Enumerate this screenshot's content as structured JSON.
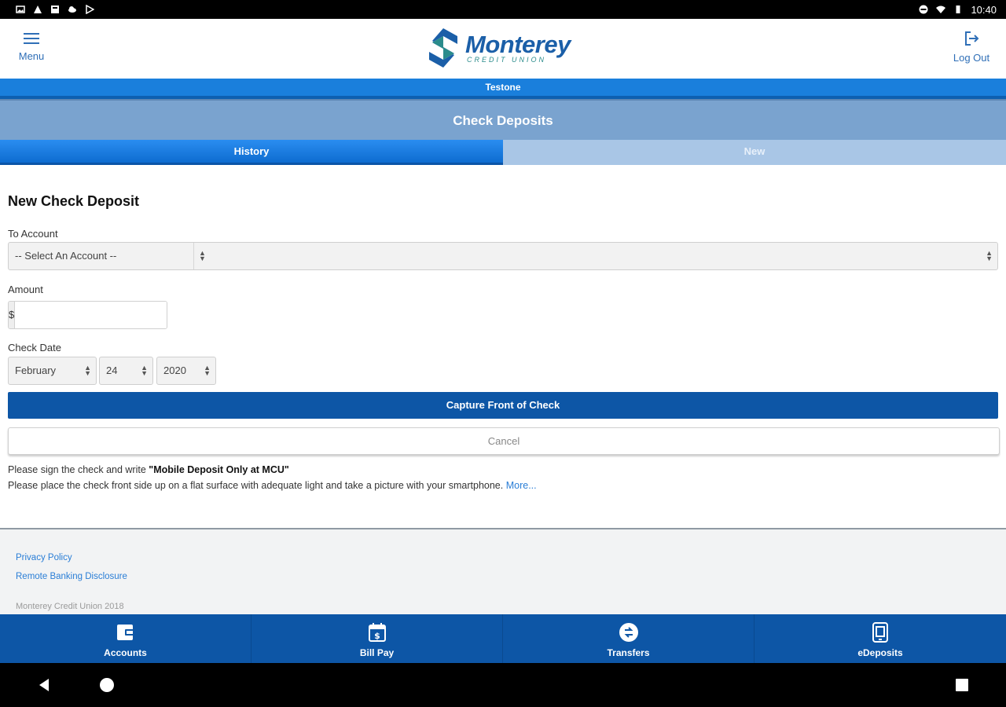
{
  "status_bar": {
    "time": "10:40"
  },
  "header": {
    "menu_label": "Menu",
    "logout_label": "Log Out",
    "logo_title": "Monterey",
    "logo_subtitle": "CREDIT UNION"
  },
  "user_bar": {
    "name": "Testone"
  },
  "page_title": "Check Deposits",
  "tabs": [
    {
      "label": "History",
      "active": true
    },
    {
      "label": "New",
      "active": false
    }
  ],
  "form": {
    "title": "New Check Deposit",
    "account_label": "To Account",
    "account_value": "-- Select An Account --",
    "amount_label": "Amount",
    "currency_symbol": "$",
    "amount_value": "",
    "date_label": "Check Date",
    "month": "February",
    "day": "24",
    "year": "2020",
    "capture_label": "Capture Front of Check",
    "cancel_label": "Cancel"
  },
  "instructions": {
    "line1_prefix": "Please sign the check and write ",
    "line1_bold": "\"Mobile Deposit Only at MCU\"",
    "line2": "Please place the check front side up on a flat surface with adequate light and take a picture with your smartphone.",
    "more_link": "More..."
  },
  "footer": {
    "privacy_link": "Privacy Policy",
    "disclosure_link": "Remote Banking Disclosure",
    "copyright": "Monterey Credit Union 2018"
  },
  "bottom_nav": [
    {
      "label": "Accounts",
      "icon": "wallet-icon"
    },
    {
      "label": "Bill Pay",
      "icon": "bill-calendar-icon"
    },
    {
      "label": "Transfers",
      "icon": "transfer-icon"
    },
    {
      "label": "eDeposits",
      "icon": "mobile-deposit-icon"
    }
  ],
  "colors": {
    "brand_blue": "#0d56a6",
    "accent_blue": "#1a7fdc",
    "title_bar": "#7aa3cf",
    "link": "#2a7ed6"
  }
}
